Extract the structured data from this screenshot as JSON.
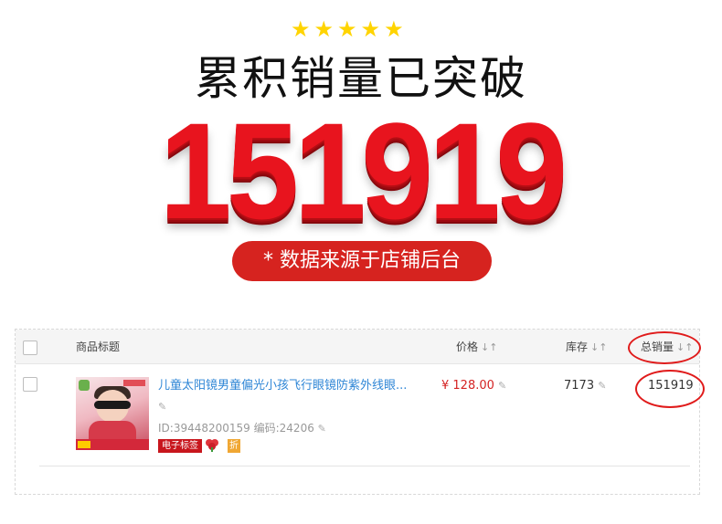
{
  "promo": {
    "stars": [
      "★",
      "★",
      "★",
      "★",
      "★"
    ],
    "headline": "累积销量已突破",
    "big_number": "151919",
    "note": "* 数据来源于店铺后台"
  },
  "table": {
    "columns": {
      "title": "商品标题",
      "price": "价格",
      "stock": "库存",
      "sales": "总销量"
    },
    "sort_glyph": "↓↑",
    "rows": [
      {
        "title": "儿童太阳镜男童偏光小孩飞行眼镜防紫外线眼...",
        "meta": "ID:39448200159 编码:24206",
        "tags": {
          "electronic_label": "电子标签",
          "discount": "折"
        },
        "price": "¥ 128.00",
        "stock": "7173",
        "sales": "151919"
      }
    ]
  },
  "colors": {
    "accent_red": "#d6231f",
    "link_blue": "#2f86d6",
    "star_yellow": "#ffd400"
  },
  "icons": {
    "edit": "pencil-icon",
    "sort": "sort-icon",
    "flower": "flower-badge-icon"
  }
}
